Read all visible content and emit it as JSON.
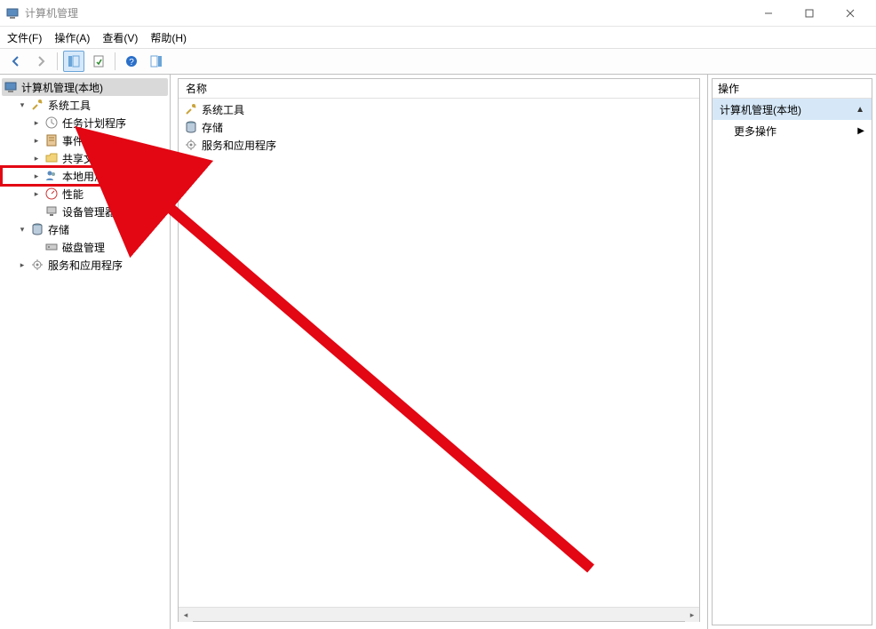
{
  "window": {
    "title": "计算机管理"
  },
  "menubar": {
    "file": "文件(F)",
    "action": "操作(A)",
    "view": "查看(V)",
    "help": "帮助(H)"
  },
  "tree": {
    "root": "计算机管理(本地)",
    "system_tools": "系统工具",
    "task_scheduler": "任务计划程序",
    "event_viewer": "事件查看器",
    "shared_folders": "共享文件夹",
    "local_users_groups": "本地用户和组",
    "performance": "性能",
    "device_manager": "设备管理器",
    "storage": "存储",
    "disk_management": "磁盘管理",
    "services_apps": "服务和应用程序"
  },
  "list": {
    "header_name": "名称",
    "items": [
      "系统工具",
      "存储",
      "服务和应用程序"
    ]
  },
  "actions": {
    "header": "操作",
    "context": "计算机管理(本地)",
    "more": "更多操作"
  }
}
